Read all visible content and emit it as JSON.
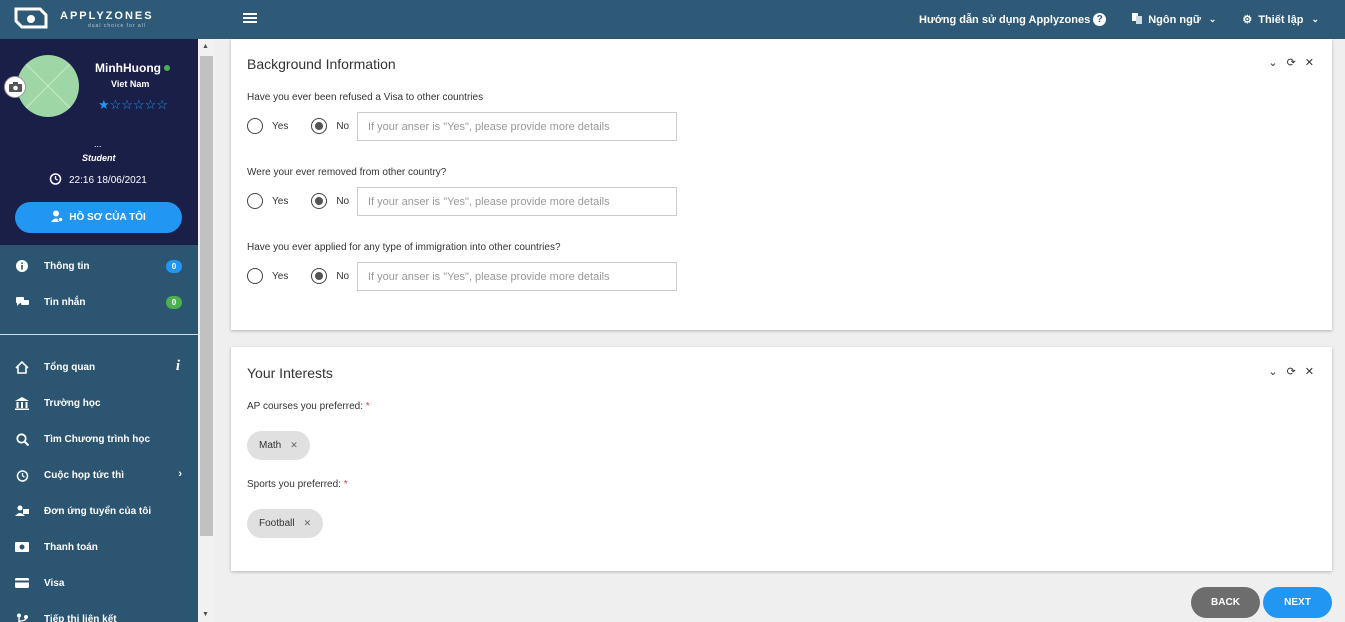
{
  "topbar": {
    "logo_text": "APPLYZONES",
    "logo_sub": "dual choice for all",
    "help_label": "Hướng dẫn sử dụng Applyzones",
    "language_label": "Ngôn ngữ",
    "settings_label": "Thiết lập"
  },
  "profile": {
    "name": "MinhHuong",
    "country": "Viet Nam",
    "rating": "★☆☆☆☆☆",
    "dots": "...",
    "role": "Student",
    "datetime": "22:16 18/06/2021",
    "button_label": "HỒ SƠ CỦA TÔI"
  },
  "sidebar": {
    "notify_items": [
      {
        "label": "Thông tin",
        "badge": "0",
        "badge_color": "#2196f3",
        "icon": "info-icon"
      },
      {
        "label": "Tin nhắn",
        "badge": "0",
        "badge_color": "#4caf50",
        "icon": "chat-icon"
      }
    ],
    "menu_items": [
      {
        "label": "Tổng quan",
        "icon": "home-icon"
      },
      {
        "label": "Trường học",
        "icon": "school-icon"
      },
      {
        "label": "Tìm Chương trình học",
        "icon": "search-icon"
      },
      {
        "label": "Cuộc họp tức thì",
        "icon": "alarm-icon"
      },
      {
        "label": "Đơn ứng tuyển của tôi",
        "icon": "applications-icon"
      },
      {
        "label": "Thanh toán",
        "icon": "payment-icon"
      },
      {
        "label": "Visa",
        "icon": "card-icon"
      },
      {
        "label": "Tiếp thị liên kết",
        "icon": "affiliate-icon"
      }
    ]
  },
  "background": {
    "title": "Background Information",
    "questions": [
      {
        "label": "Have you ever been refused a Visa to other countries",
        "yes": "Yes",
        "no": "No",
        "selected": "No",
        "placeholder": "If your anser is \"Yes\", please provide more details"
      },
      {
        "label": "Were your ever removed from other country?",
        "yes": "Yes",
        "no": "No",
        "selected": "No",
        "placeholder": "If your anser is \"Yes\", please provide more details"
      },
      {
        "label": "Have you ever applied for any type of immigration into other countries?",
        "yes": "Yes",
        "no": "No",
        "selected": "No",
        "placeholder": "If your anser is \"Yes\", please provide more details"
      }
    ]
  },
  "interests": {
    "title": "Your Interests",
    "ap_label": "AP courses you preferred:",
    "ap_chips": [
      "Math"
    ],
    "sports_label": "Sports you preferred:",
    "sports_chips": [
      "Football"
    ],
    "required_mark": "*"
  },
  "actions": {
    "back_label": "BACK",
    "next_label": "NEXT",
    "back_color": "#6d6d6d",
    "next_color": "#2196f3"
  }
}
